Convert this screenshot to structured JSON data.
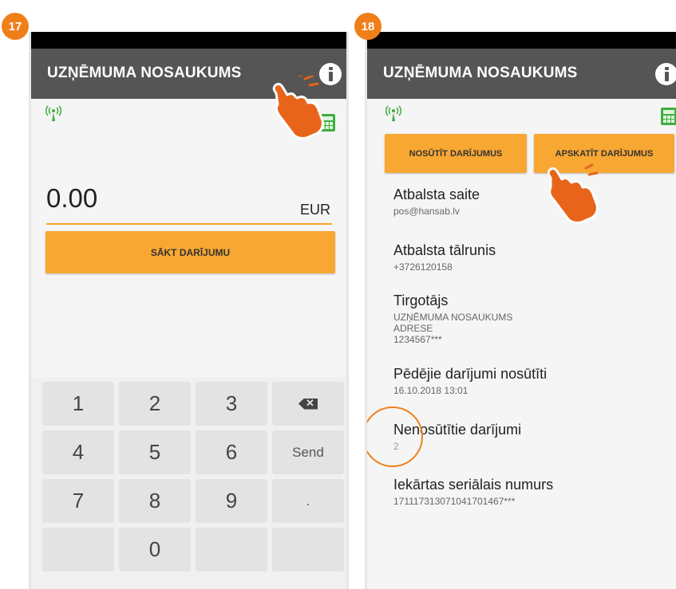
{
  "colors": {
    "accent": "#f8a732",
    "badge": "#f07f1a",
    "appbar": "#555555",
    "icon_green": "#3fae3f"
  },
  "step17": {
    "badge": "17",
    "app_title": "UZŅĒMUMA NOSAUKUMS",
    "amount": "0.00",
    "currency": "EUR",
    "start_button": "SĀKT DARĪJUMU",
    "keypad": {
      "row1": [
        "1",
        "2",
        "3"
      ],
      "row2": [
        "4",
        "5",
        "6",
        "Send"
      ],
      "row3": [
        "7",
        "8",
        "9",
        "."
      ],
      "row4": [
        "0"
      ]
    },
    "icons": [
      "signal-icon",
      "info-icon",
      "calculator-icon",
      "backspace-icon",
      "pointing-hand-icon"
    ]
  },
  "step18": {
    "badge": "18",
    "app_title": "UZŅĒMUMA NOSAUKUMS",
    "send_button": "NOSŪTĪT DARĪJUMUS",
    "view_button": "APSKATĪT DARĪJUMUS",
    "support_link": {
      "title": "Atbalsta saite",
      "value": "pos@hansab.lv"
    },
    "support_phone": {
      "title": "Atbalsta tālrunis",
      "value": "+3726120158"
    },
    "merchant": {
      "title": "Tirgotājs",
      "name": "UZŅĒMUMA NOSAUKUMS",
      "address": "ADRESE",
      "id": "1234567***"
    },
    "last_sent": {
      "title": "Pēdējie darījumi nosūtīti",
      "value": "16.10.2018 13:01"
    },
    "unsent": {
      "title": "Nenosūtītie darījumi",
      "value": "2"
    },
    "serial": {
      "title": "Iekārtas seriālais numurs",
      "value": "171117313071041701467***"
    }
  }
}
